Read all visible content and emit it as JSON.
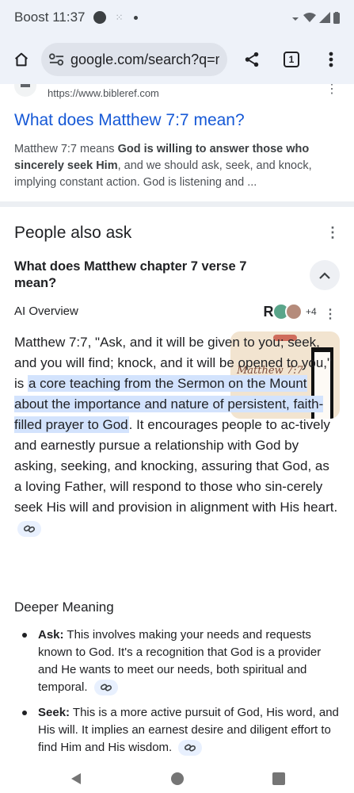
{
  "status_bar": {
    "carrier": "Boost",
    "time": "11:37"
  },
  "toolbar": {
    "url": "google.com/search?q=m",
    "tab_count": "1"
  },
  "result": {
    "source_url": "https://www.bibleref.com",
    "title": "What does Matthew 7:7 mean?",
    "snippet_pre": "Matthew 7:7 means ",
    "snippet_bold": "God is willing to answer those who sincerely seek Him",
    "snippet_post": ", and we should ask, seek, and knock, implying constant action. God is listening and ..."
  },
  "people_also_ask": {
    "title": "People also ask",
    "question": "What does Matthew chapter 7 verse 7 mean?"
  },
  "ai_overview": {
    "label": "AI Overview",
    "avatar_letter": "R",
    "extra_count": "+4",
    "thumbnail_text": "Matthew 7:7",
    "body_pre": "Matthew 7:7, \"Ask, and it will be given to you; seek, and you will find; knock, and it will be opened to you,\" is ",
    "body_highlight": "a core teaching from the Sermon on the Mount about the importance and nature of persistent, faith-filled prayer to God",
    "body_post": ". It encourages people to ac-tively and earnestly pursue a relationship with God by asking, seeking, and knocking, assuring that God, as a loving Father, will respond to those who sin-cerely seek His will and provision in alignment with His heart."
  },
  "deeper": {
    "heading": "Deeper Meaning",
    "items": [
      {
        "term": "Ask:",
        "text": " This involves making your needs and requests known to God. It's a recognition that God is a provider and He wants to meet our needs, both spiritual and temporal."
      },
      {
        "term": "Seek:",
        "text": " This is a more active pursuit of God, His word, and His will. It implies an earnest desire and diligent effort to find Him and His wisdom."
      }
    ]
  },
  "colors": {
    "link_blue": "#1558d6",
    "highlight": "#d3e3fd",
    "chrome_bg": "#eef2f9"
  },
  "icons": [
    "home-icon",
    "tune-icon",
    "share-icon",
    "tab-switcher-icon",
    "more-vert-icon",
    "chevron-up-icon",
    "link-icon",
    "back-nav-icon",
    "home-nav-icon",
    "recents-nav-icon"
  ]
}
